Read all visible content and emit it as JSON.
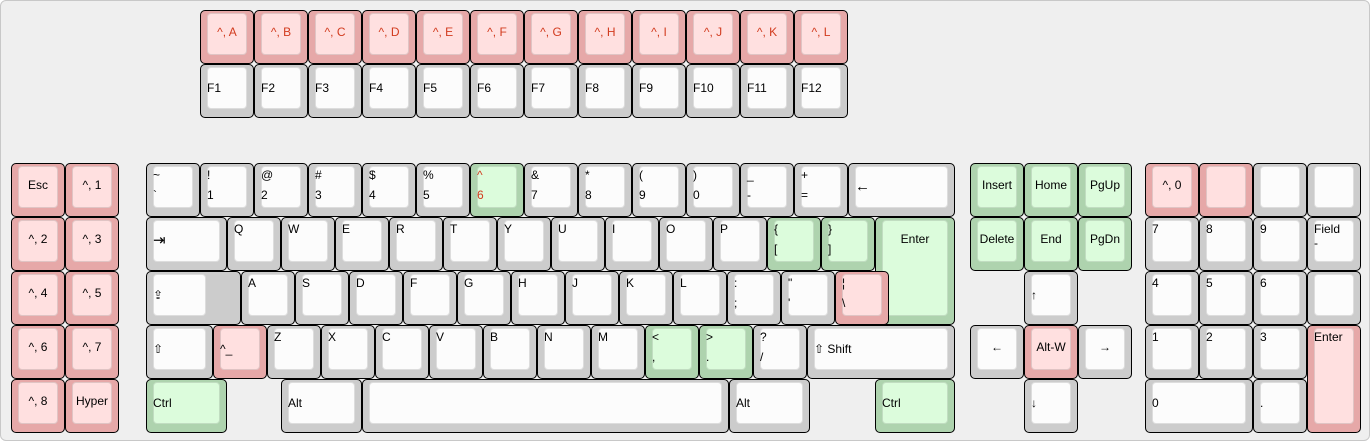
{
  "colors": {
    "normal": "#fcfcfc",
    "pink": "#ffe0e0",
    "green": "#dcfcdc",
    "red_text": "#d23b1e"
  },
  "fnrow_top": [
    "^, A",
    "^, B",
    "^, C",
    "^, D",
    "^, E",
    "^, F",
    "^, G",
    "^, H",
    "^, I",
    "^, J",
    "^, K",
    "^, L"
  ],
  "fnrow": [
    "F1",
    "F2",
    "F3",
    "F4",
    "F5",
    "F6",
    "F7",
    "F8",
    "F9",
    "F10",
    "F11",
    "F12"
  ],
  "left_cluster": [
    "Esc",
    "^, 1",
    "^, 2",
    "^, 3",
    "^, 4",
    "^, 5",
    "^, 6",
    "^, 7",
    "^, 8",
    "Hyper"
  ],
  "number_row": [
    {
      "t": "~",
      "b": "`"
    },
    {
      "t": "!",
      "b": "1"
    },
    {
      "t": "@",
      "b": "2"
    },
    {
      "t": "#",
      "b": "3"
    },
    {
      "t": "$",
      "b": "4"
    },
    {
      "t": "%",
      "b": "5"
    },
    {
      "t": "^",
      "b": "6"
    },
    {
      "t": "&",
      "b": "7"
    },
    {
      "t": "*",
      "b": "8"
    },
    {
      "t": "(",
      "b": "9"
    },
    {
      "t": ")",
      "b": "0"
    },
    {
      "t": "_",
      "b": "-"
    },
    {
      "t": "+",
      "b": "="
    }
  ],
  "backspace": "←",
  "tab": "⇥",
  "qwerty": [
    "Q",
    "W",
    "E",
    "R",
    "T",
    "Y",
    "U",
    "I",
    "O",
    "P"
  ],
  "brackets": [
    {
      "t": "{",
      "b": "["
    },
    {
      "t": "}",
      "b": "]"
    }
  ],
  "enter": "Enter",
  "caps": "⇪",
  "asdf": [
    "A",
    "S",
    "D",
    "F",
    "G",
    "H",
    "J",
    "K",
    "L"
  ],
  "semi": {
    "t": ":",
    "b": ";"
  },
  "quote": {
    "t": "\"",
    "b": "'"
  },
  "pipe": {
    "t": "¦",
    "b": "\\"
  },
  "lshift": "⇧",
  "underscore": "^_",
  "zxcv": [
    "Z",
    "X",
    "C",
    "V",
    "B",
    "N",
    "M"
  ],
  "lt": {
    "t": "<",
    "b": ","
  },
  "gt": {
    "t": ">",
    "b": "."
  },
  "qmark": {
    "t": "?",
    "b": "/"
  },
  "rshift": "⇧ Shift",
  "bottom": {
    "ctrl": "Ctrl",
    "alt": "Alt",
    "space": "",
    "ralt": "Alt",
    "rctrl": "Ctrl"
  },
  "nav": {
    "insert": "Insert",
    "home": "Home",
    "pgup": "PgUp",
    "delete": "Delete",
    "end": "End",
    "pgdn": "PgDn",
    "up": "↑",
    "left": "←",
    "altw": "Alt-W",
    "right": "→",
    "down": "↓"
  },
  "numpad": {
    "r0": [
      "^, 0",
      "",
      "",
      ""
    ],
    "r1": [
      "7",
      "8",
      "9",
      "Field\n-"
    ],
    "r2": [
      "4",
      "5",
      "6",
      ""
    ],
    "r3": [
      "1",
      "2",
      "3"
    ],
    "enter": "Enter",
    "zero": "0",
    "dot": "."
  }
}
